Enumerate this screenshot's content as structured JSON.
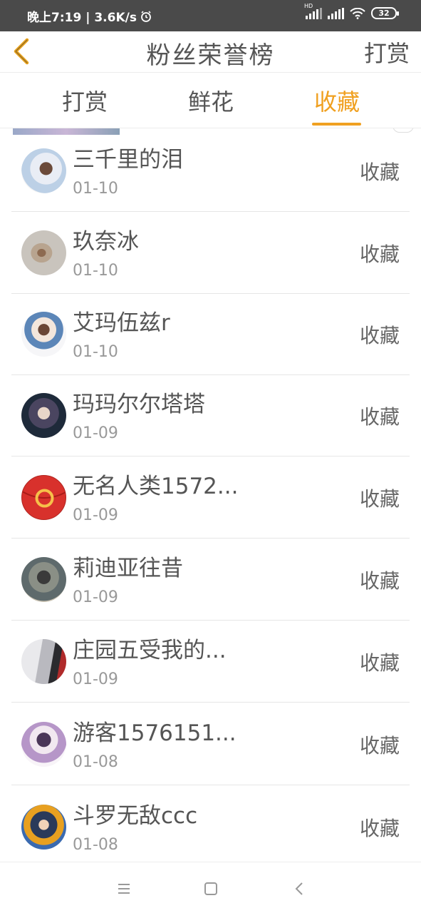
{
  "status_bar": {
    "time_speed": "晚上7:19 | 3.6K/s",
    "hd_label": "HD",
    "battery": "32"
  },
  "header": {
    "title": "粉丝荣誉榜",
    "action_label": "打赏",
    "back_icon": "chevron-left-icon"
  },
  "tabs": [
    {
      "label": "打赏"
    },
    {
      "label": "鲜花"
    },
    {
      "label": "收藏",
      "active": true
    }
  ],
  "colors": {
    "accent": "#f0a020",
    "text": "#555555",
    "subtext": "#999999",
    "status_bar": "#4a4a4a"
  },
  "list": [
    {
      "name": "三千里的泪",
      "date": "01-10",
      "action": "收藏"
    },
    {
      "name": "玖奈冰",
      "date": "01-10",
      "action": "收藏"
    },
    {
      "name": "艾玛伍兹r",
      "date": "01-10",
      "action": "收藏"
    },
    {
      "name": "玛玛尔尔塔塔",
      "date": "01-09",
      "action": "收藏"
    },
    {
      "name": "无名人类1572...",
      "date": "01-09",
      "action": "收藏"
    },
    {
      "name": "莉迪亚往昔",
      "date": "01-09",
      "action": "收藏"
    },
    {
      "name": "庄园五受我的...",
      "date": "01-09",
      "action": "收藏"
    },
    {
      "name": "游客1576151...",
      "date": "01-08",
      "action": "收藏"
    },
    {
      "name": "斗罗无敌ccc",
      "date": "01-08",
      "action": "收藏"
    }
  ],
  "nav_bar": {
    "menu_icon": "menu-icon",
    "home_icon": "home-square-icon",
    "back_icon": "back-triangle-icon"
  }
}
